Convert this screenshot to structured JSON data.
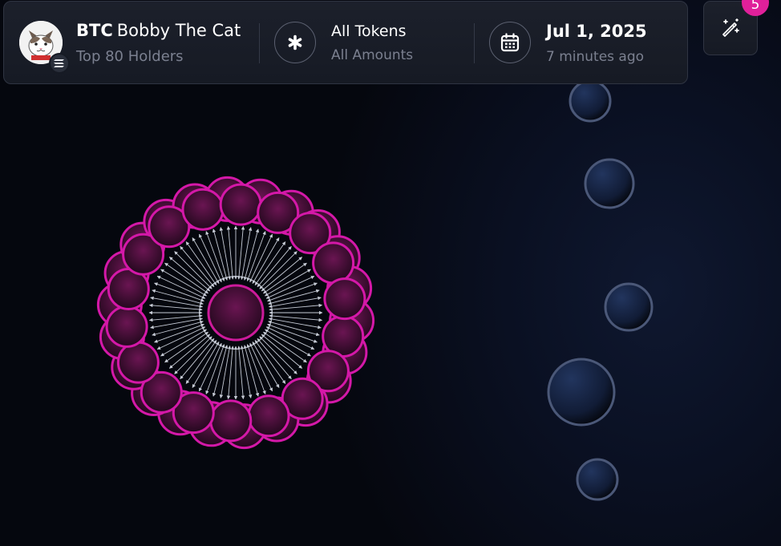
{
  "token": {
    "symbol": "BTC",
    "name": "Bobby The Cat",
    "subtitle": "Top 80 Holders",
    "avatar_icon": "cat-face-icon",
    "chain_icon": "solana-icon"
  },
  "filter": {
    "icon": "asterisk-icon",
    "title": "All Tokens",
    "subtitle": "All Amounts"
  },
  "date": {
    "icon": "calendar-icon",
    "title": "Jul 1, 2025",
    "subtitle": "7 minutes ago"
  },
  "tools": {
    "icon": "magic-wand-icon",
    "badge_count": "5"
  },
  "colors": {
    "accent_pink": "#e0209a",
    "cluster_fill": "#3a0b2c",
    "isolated_node_stroke": "#4b5878",
    "isolated_node_fill": "#1a2744",
    "arrow": "#c7ccd6"
  },
  "graph": {
    "cluster": {
      "center_node": "hub-holder",
      "outer_holder_count": 40,
      "arrow_count": 72
    },
    "isolated_holders": 5
  }
}
